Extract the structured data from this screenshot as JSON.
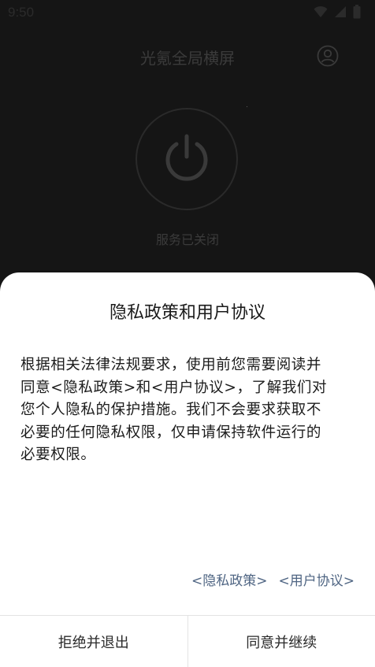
{
  "status_bar": {
    "time": "9:50",
    "icons": [
      "wifi-icon",
      "cellular-signal-icon",
      "battery-icon"
    ]
  },
  "header": {
    "title": "光氪全局横屏",
    "account_icon": "account-circle-icon"
  },
  "service": {
    "power_icon": "power-icon",
    "status_text": "服务已关闭"
  },
  "dialog": {
    "title": "隐私政策和用户协议",
    "body_lines": [
      "根据相关法律法规要求，使用前您需要阅读并",
      "同意<隐私政策>和<用户协议>，了解我们对",
      "您个人隐私的保护措施。我们不会要求获取不",
      "必要的任何隐私权限，仅申请保持软件运行的",
      "必要权限。"
    ],
    "privacy_link": "<隐私政策>",
    "terms_link": "<用户协议>",
    "reject_label": "拒绝并退出",
    "accept_label": "同意并继续"
  },
  "colors": {
    "background_dim": "#151515",
    "dialog_bg": "#ffffff",
    "link": "#4f6583",
    "text": "#1c1c1c"
  }
}
